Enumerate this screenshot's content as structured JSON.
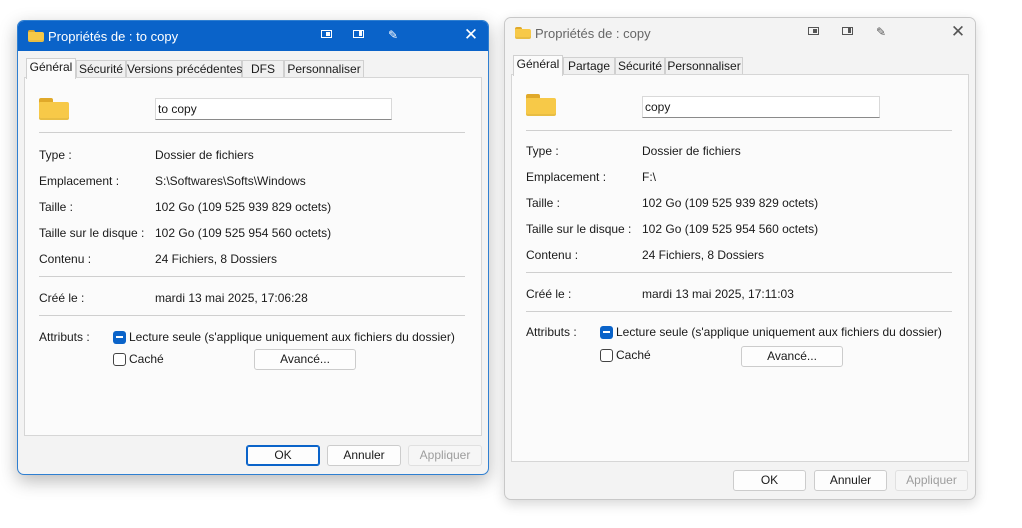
{
  "win1": {
    "title": "Propriétés de : to copy",
    "tabs": [
      "Général",
      "Sécurité",
      "Versions précédentes",
      "DFS",
      "Personnaliser"
    ],
    "name": "to copy",
    "rows": [
      {
        "label": "Type :",
        "value": "Dossier de fichiers"
      },
      {
        "label": "Emplacement :",
        "value": "S:\\Softwares\\Softs\\Windows"
      },
      {
        "label": "Taille :",
        "value": "102 Go (109 525 939 829 octets)"
      },
      {
        "label": "Taille sur le disque :",
        "value": "102 Go (109 525 954 560 octets)"
      },
      {
        "label": "Contenu :",
        "value": "24 Fichiers, 8 Dossiers"
      }
    ],
    "created_label": "Créé le :",
    "created_value": "mardi 13 mai 2025, 17:06:28",
    "attributes_label": "Attributs :",
    "readonly_label": "Lecture seule (s'applique uniquement aux fichiers du dossier)",
    "hidden_label": "Caché",
    "advanced_label": "Avancé...",
    "ok_label": "OK",
    "cancel_label": "Annuler",
    "apply_label": "Appliquer"
  },
  "win2": {
    "title": "Propriétés de : copy",
    "tabs": [
      "Général",
      "Partage",
      "Sécurité",
      "Personnaliser"
    ],
    "name": "copy",
    "rows": [
      {
        "label": "Type :",
        "value": "Dossier de fichiers"
      },
      {
        "label": "Emplacement :",
        "value": "F:\\"
      },
      {
        "label": "Taille :",
        "value": "102 Go (109 525 939 829 octets)"
      },
      {
        "label": "Taille sur le disque :",
        "value": "102 Go (109 525 954 560 octets)"
      },
      {
        "label": "Contenu :",
        "value": "24 Fichiers, 8 Dossiers"
      }
    ],
    "created_label": "Créé le :",
    "created_value": "mardi 13 mai 2025, 17:11:03",
    "attributes_label": "Attributs :",
    "readonly_label": "Lecture seule (s'applique uniquement aux fichiers du dossier)",
    "hidden_label": "Caché",
    "advanced_label": "Avancé...",
    "ok_label": "OK",
    "cancel_label": "Annuler",
    "apply_label": "Appliquer"
  },
  "colors": {
    "accent": "#0a63c9",
    "folder": "#f7c948",
    "disabled_text": "#9d9d9d"
  },
  "icons": [
    "folder-icon",
    "compact-view-icon",
    "snap-icon",
    "pin-icon",
    "close-icon",
    "checkbox-indeterminate-icon",
    "checkbox-empty-icon"
  ]
}
